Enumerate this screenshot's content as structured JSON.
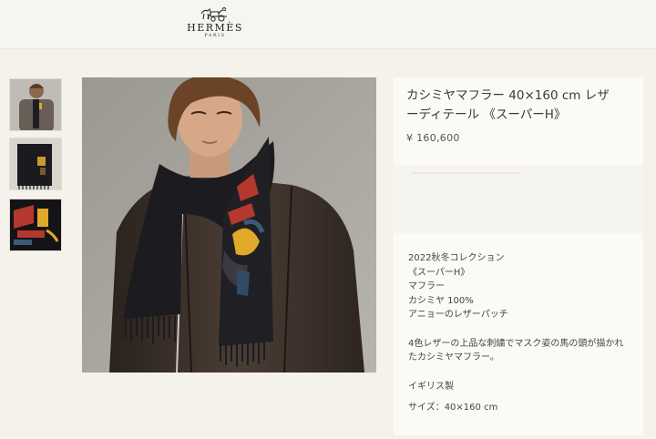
{
  "header": {
    "brand": "HERMÈS",
    "brand_sub": "PARIS",
    "logo_icon": "horse-carriage-logo-icon"
  },
  "thumbnails": [
    {
      "label": "product-thumb-model",
      "active": true
    },
    {
      "label": "product-thumb-scarf-detail",
      "active": false
    },
    {
      "label": "product-thumb-scarf-folded",
      "active": false
    }
  ],
  "product": {
    "title_line1": "カシミヤマフラー 40×160 cm レザ",
    "title_line2": "ーディテール 《スーパーH》",
    "price": "¥ 160,600"
  },
  "description": {
    "specs": [
      "2022秋冬コレクション",
      "《スーパーH》",
      "マフラー",
      "カシミヤ 100%",
      "アニョーのレザーパッチ"
    ],
    "text_lines": [
      "4色レザーの上品な刺繍でマスク姿の馬の頭が描かれ",
      "たカシミヤマフラー。"
    ],
    "origin": "イギリス製",
    "size": "サイズ：40×160 cm"
  },
  "colors": {
    "background": "#f5f2ec",
    "panel": "#fbfaf7",
    "scarf": "#1c1c20",
    "jacket": "#3a2f28",
    "accent_yellow": "#e0a92a",
    "accent_red": "#b5382f"
  }
}
